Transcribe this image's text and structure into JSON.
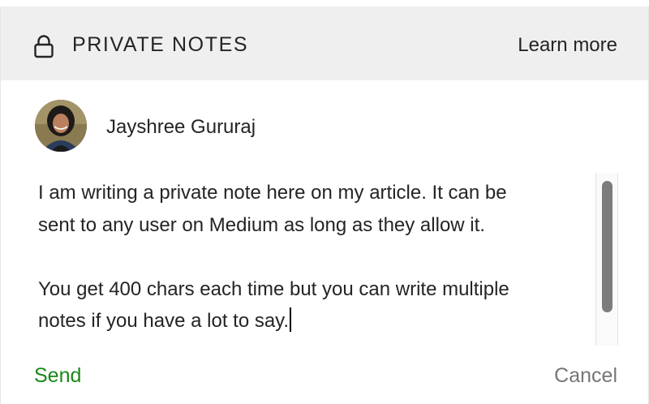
{
  "header": {
    "title": "PRIVATE NOTES",
    "learn_more": "Learn more",
    "icon": "lock-icon"
  },
  "author": {
    "name": "Jayshree Gururaj"
  },
  "note": {
    "text": "I am writing a private note here on my article. It can be\nsent to any user on Medium as long as they allow it.\n\nYou get 400 chars each time but you can write multiple\nnotes if you have a lot to say."
  },
  "actions": {
    "send": "Send",
    "cancel": "Cancel"
  },
  "colors": {
    "header_bg": "#efefef",
    "send": "#1a8917",
    "cancel": "#757575",
    "text": "#242424"
  }
}
